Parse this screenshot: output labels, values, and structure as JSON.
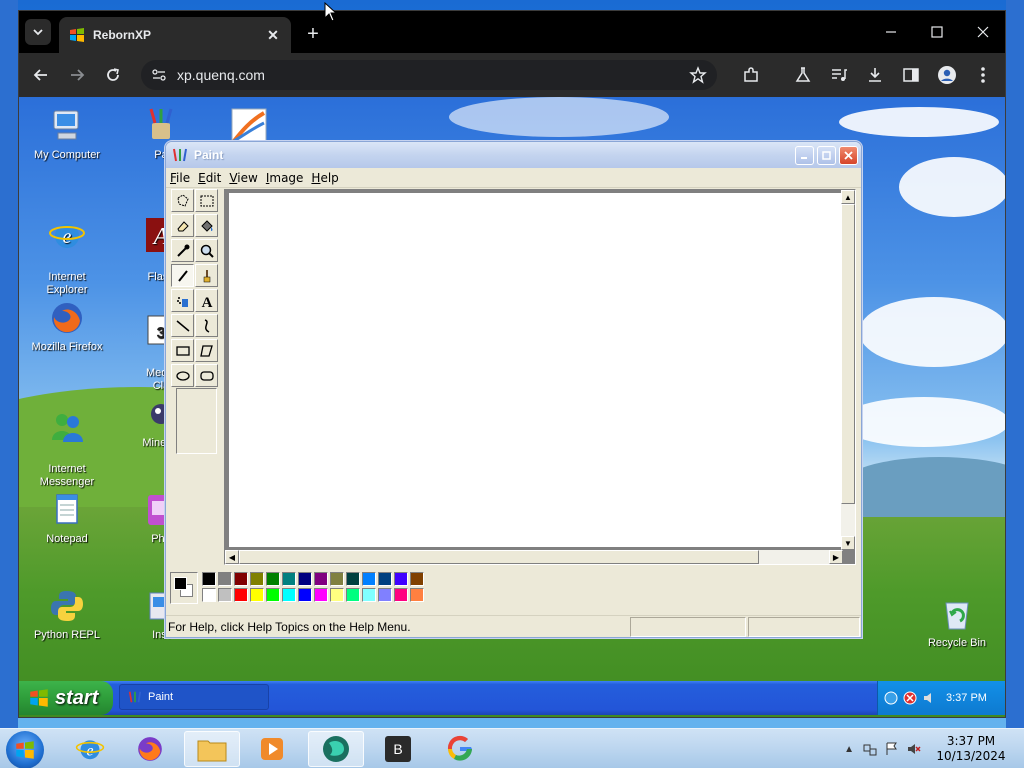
{
  "browser": {
    "tab_title": "RebornXP",
    "url": "xp.quenq.com",
    "colors": {
      "frame": "#000000",
      "toolbar": "#2b2b2b"
    }
  },
  "desktop": {
    "icons_left": [
      {
        "label": "My Computer"
      },
      {
        "label": "Internet\nExplorer"
      },
      {
        "label": "Mozilla Firefox"
      },
      {
        "label": "Internet\nMessenger"
      },
      {
        "label": "Notepad"
      },
      {
        "label": "Python REPL"
      }
    ],
    "icons_col2": [
      {
        "label": "Pa"
      },
      {
        "label": "Flash"
      },
      {
        "label": "Media\nCla"
      },
      {
        "label": "Minesw"
      },
      {
        "label": "Pho"
      },
      {
        "label": "Inst"
      }
    ],
    "recycle_bin": "Recycle Bin"
  },
  "paint": {
    "title": "Paint",
    "menu": [
      "File",
      "Edit",
      "View",
      "Image",
      "Help"
    ],
    "status_text": "For Help, click Help Topics on the Help Menu.",
    "palette_top": [
      "#000000",
      "#808080",
      "#800000",
      "#808000",
      "#008000",
      "#008080",
      "#000080",
      "#800080",
      "#808040",
      "#004040",
      "#0080ff",
      "#004080",
      "#4000ff",
      "#804000"
    ],
    "palette_bottom": [
      "#ffffff",
      "#c0c0c0",
      "#ff0000",
      "#ffff00",
      "#00ff00",
      "#00ffff",
      "#0000ff",
      "#ff00ff",
      "#ffff80",
      "#00ff80",
      "#80ffff",
      "#8080ff",
      "#ff0080",
      "#ff8040"
    ]
  },
  "xp_taskbar": {
    "start_label": "start",
    "task_label": "Paint",
    "clock": "3:37 PM"
  },
  "win7_taskbar": {
    "time": "3:37 PM",
    "date": "10/13/2024",
    "app_b_label": "B"
  }
}
